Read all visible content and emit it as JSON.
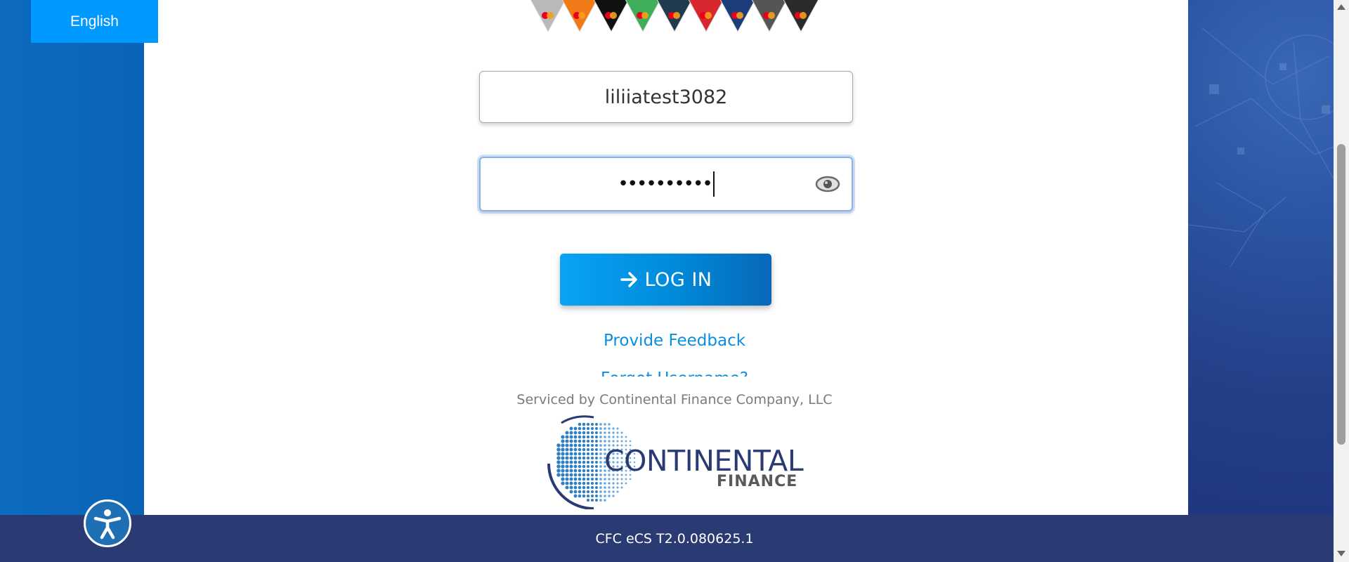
{
  "language": {
    "label": "English"
  },
  "login": {
    "username_value": "liliiatest3082",
    "password_masked": "••••••••••",
    "show_password_icon": "eye-icon",
    "login_button_label": "LOG IN",
    "login_icon": "arrow-right-icon"
  },
  "links": {
    "feedback": "Provide Feedback",
    "forgot_username_partial": "Forgot Username?"
  },
  "serviced_by": "Serviced by Continental Finance Company, LLC",
  "brand": {
    "name": "CONTINENTAL",
    "sub": "FINANCE",
    "primary_color": "#2a3a72",
    "accent_color": "#0099ff"
  },
  "footer": {
    "version": "CFC eCS T2.0.080625.1"
  },
  "accessibility": {
    "icon": "accessibility-icon"
  },
  "card_strip": {
    "colors": [
      "#b9b9b9",
      "#f07a18",
      "#111111",
      "#3fae5a",
      "#1f3b4d",
      "#d7262e",
      "#1b3d7a",
      "#555555",
      "#2b2b2b"
    ]
  }
}
